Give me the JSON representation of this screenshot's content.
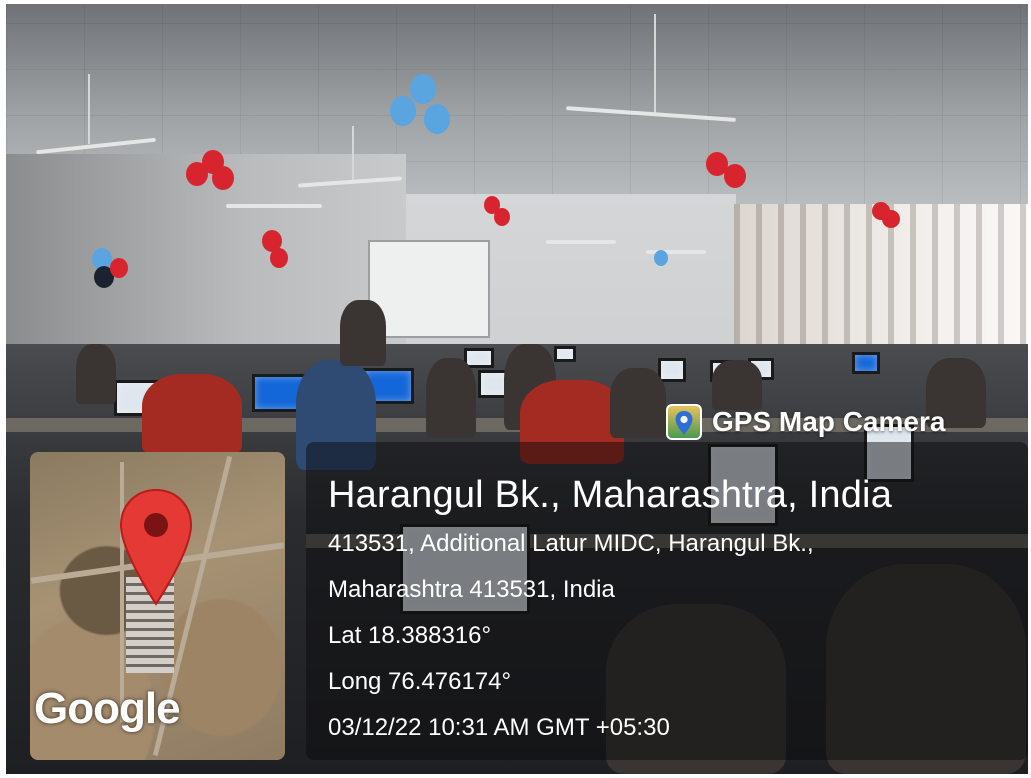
{
  "overlay": {
    "brand": "GPS Map Camera",
    "brand_icon": "map-pin-camera-icon",
    "place_title": "Harangul Bk., Maharashtra, India",
    "address_line1": "413531, Additional Latur MIDC, Harangul Bk.,",
    "address_line2": "Maharashtra 413531, India",
    "latitude": "Lat 18.388316°",
    "longitude": "Long 76.476174°",
    "datetime": "03/12/22 10:31 AM GMT +05:30"
  },
  "map": {
    "wordmark": "Google",
    "pin_icon": "map-pin-icon",
    "pin_color": "#e53935"
  },
  "scene": {
    "description_icon": "classroom-photo"
  }
}
